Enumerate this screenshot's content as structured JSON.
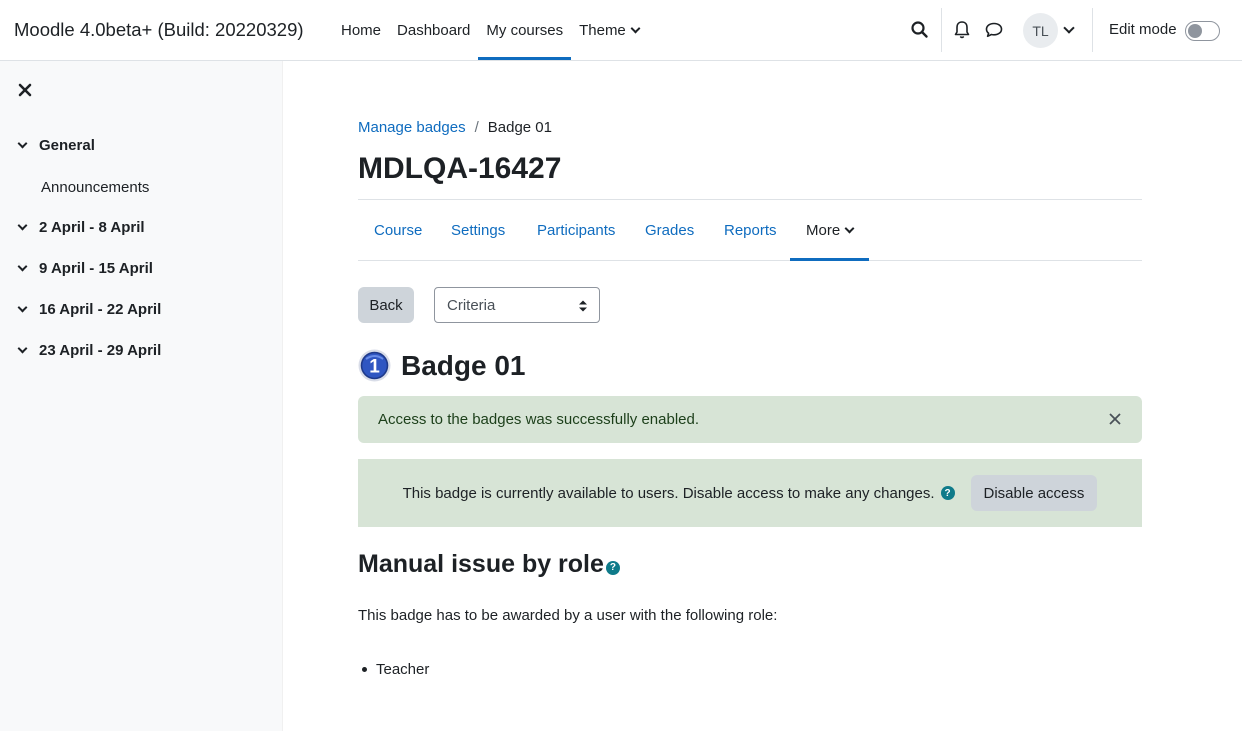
{
  "navbar": {
    "brand": "Moodle 4.0beta+ (Build: 20220329)",
    "items": [
      {
        "label": "Home"
      },
      {
        "label": "Dashboard"
      },
      {
        "label": "My courses"
      },
      {
        "label": "Theme"
      }
    ],
    "avatar_initials": "TL",
    "edit_mode_label": "Edit mode"
  },
  "drawer": {
    "sections": [
      {
        "label": "General"
      },
      {
        "label": "2 April - 8 April"
      },
      {
        "label": "9 April - 15 April"
      },
      {
        "label": "16 April - 22 April"
      },
      {
        "label": "23 April - 29 April"
      }
    ],
    "activities": [
      {
        "label": "Announcements"
      }
    ]
  },
  "breadcrumb": {
    "link": "Manage badges",
    "separator": "/",
    "current": "Badge 01"
  },
  "course_title": "MDLQA-16427",
  "secondary_nav": [
    {
      "label": "Course"
    },
    {
      "label": "Settings"
    },
    {
      "label": "Participants"
    },
    {
      "label": "Grades"
    },
    {
      "label": "Reports"
    },
    {
      "label": "More"
    }
  ],
  "actions": {
    "back_label": "Back",
    "select_value": "Criteria"
  },
  "badge": {
    "name": "Badge 01",
    "icon_digit": "1"
  },
  "alert": {
    "message": "Access to the badges was successfully enabled."
  },
  "status": {
    "message": "This badge is currently available to users. Disable access to make any changes.",
    "help_glyph": "?",
    "button_label": "Disable access"
  },
  "criteria": {
    "heading": "Manual issue by role",
    "help_glyph": "?",
    "description": "This badge has to be awarded by a user with the following role:",
    "roles": [
      "Teacher"
    ]
  },
  "colors": {
    "link": "#0f6cbf",
    "success_bg": "#d7e4d6",
    "button_secondary": "#ced4da",
    "help_icon": "#0f7b8a"
  }
}
